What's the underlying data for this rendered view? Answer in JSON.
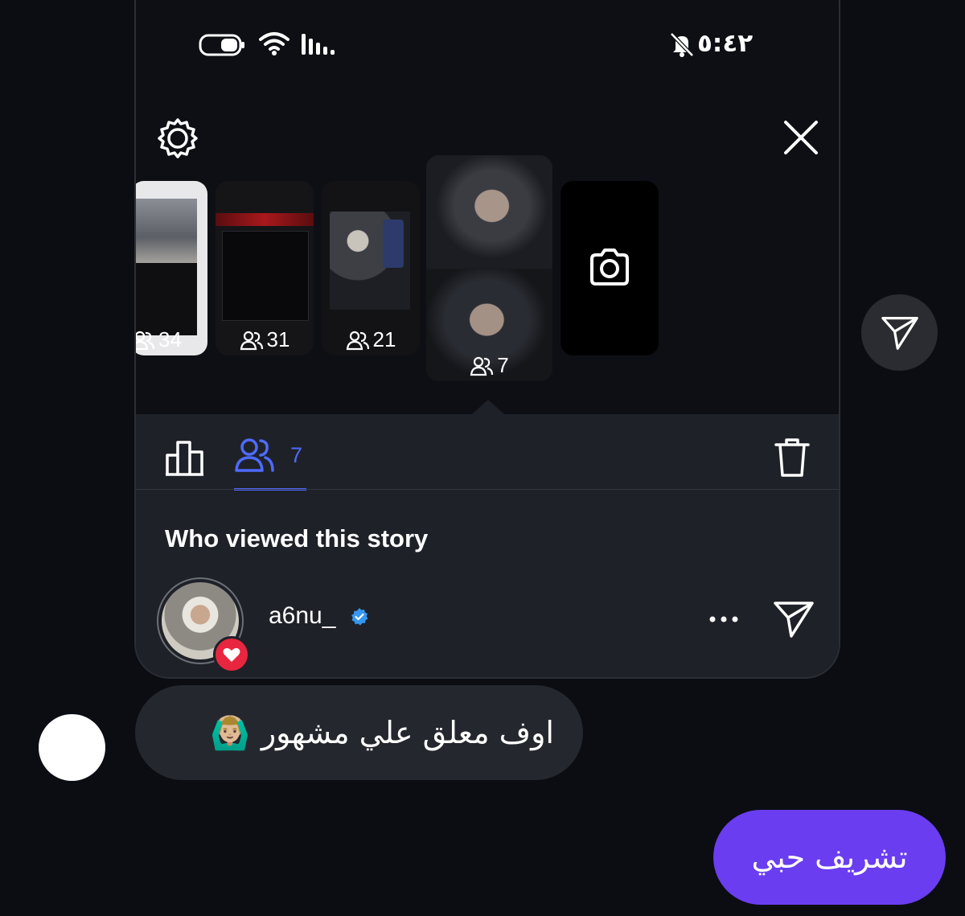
{
  "status_bar": {
    "time": "٥:٤٢"
  },
  "stories": [
    {
      "viewers": "34"
    },
    {
      "viewers": "31"
    },
    {
      "viewers": "21"
    },
    {
      "viewers": "7"
    }
  ],
  "viewers_tab": {
    "count": "7"
  },
  "section_title": "Who viewed this story",
  "viewer": {
    "username": "a6nu_"
  },
  "messages": {
    "incoming": {
      "text": "اوف معلق علي مشهور",
      "emoji": "🙆🏼‍♂️"
    },
    "outgoing": {
      "text": "تشريف حبي"
    }
  },
  "colors": {
    "background": "#0b0d13",
    "panel": "#1f2128",
    "accent_blue": "#4d6bfe",
    "bubble_incoming": "#25272e",
    "bubble_outgoing": "#6a3df0",
    "heart_badge": "#e8263f"
  },
  "icons": [
    "settings-icon",
    "close-icon",
    "camera-icon",
    "insights-icon",
    "viewers-icon",
    "trash-icon",
    "more-icon",
    "send-icon",
    "verified-icon",
    "heart-icon"
  ]
}
